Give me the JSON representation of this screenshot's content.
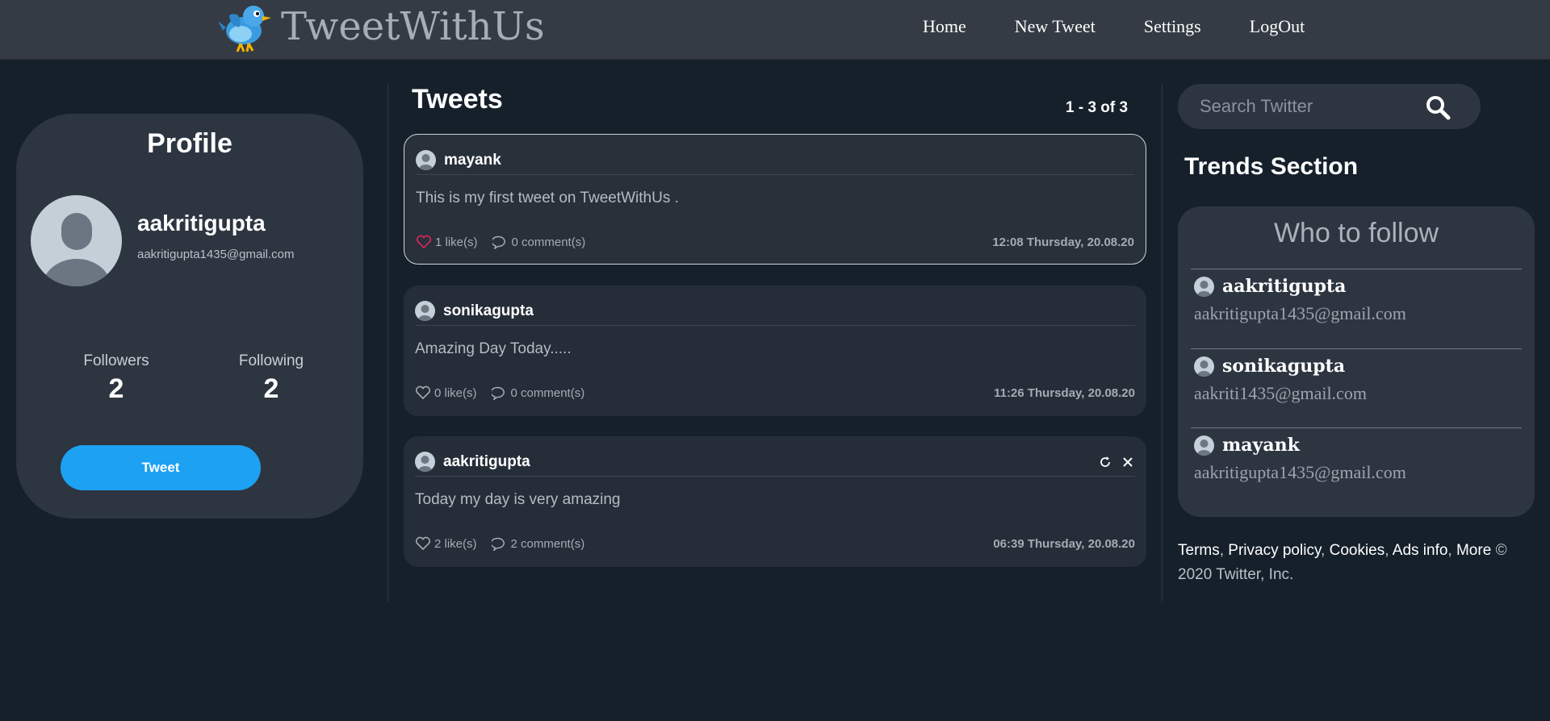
{
  "brand": {
    "name": "TweetWithUs",
    "logo_icon": "bird-logo-icon"
  },
  "nav": {
    "links": [
      "Home",
      "New Tweet",
      "Settings",
      "LogOut"
    ]
  },
  "profile": {
    "title": "Profile",
    "username": "aakritigupta",
    "email": "aakritigupta1435@gmail.com",
    "followers_label": "Followers",
    "followers_count": "2",
    "following_label": "Following",
    "following_count": "2",
    "tweet_button": "Tweet"
  },
  "tweets": {
    "title": "Tweets",
    "pager": "1 - 3 of 3",
    "items": [
      {
        "user": "mayank",
        "text": "This is my first tweet on TweetWithUs .",
        "likes": "1 like(s)",
        "comments": "0 comment(s)",
        "time": "12:08 Thursday, 20.08.20",
        "liked": true
      },
      {
        "user": "sonikagupta",
        "text": "Amazing Day Today.....",
        "likes": "0 like(s)",
        "comments": "0 comment(s)",
        "time": "11:26 Thursday, 20.08.20",
        "liked": false
      },
      {
        "user": "aakritigupta",
        "text": "Today my day is very amazing",
        "likes": "2 like(s)",
        "comments": "2 comment(s)",
        "time": "06:39 Thursday, 20.08.20",
        "liked": false
      }
    ]
  },
  "search": {
    "placeholder": "Search Twitter"
  },
  "trends": {
    "title": "Trends Section",
    "who_to_follow_title": "Who to follow",
    "suggestions": [
      {
        "name": "aakritigupta",
        "email": "aakritigupta1435@gmail.com"
      },
      {
        "name": "sonikagupta",
        "email": "aakriti1435@gmail.com"
      },
      {
        "name": "mayank",
        "email": "aakritigupta1435@gmail.com"
      }
    ]
  },
  "footer": {
    "links": [
      "Terms",
      "Privacy policy",
      "Cookies",
      "Ads info",
      "More"
    ],
    "copyright": "© 2020 Twitter, Inc."
  },
  "colors": {
    "accent": "#1da1f2",
    "background": "#15202b",
    "card": "#2c3540",
    "liked_heart": "#e0245e"
  }
}
